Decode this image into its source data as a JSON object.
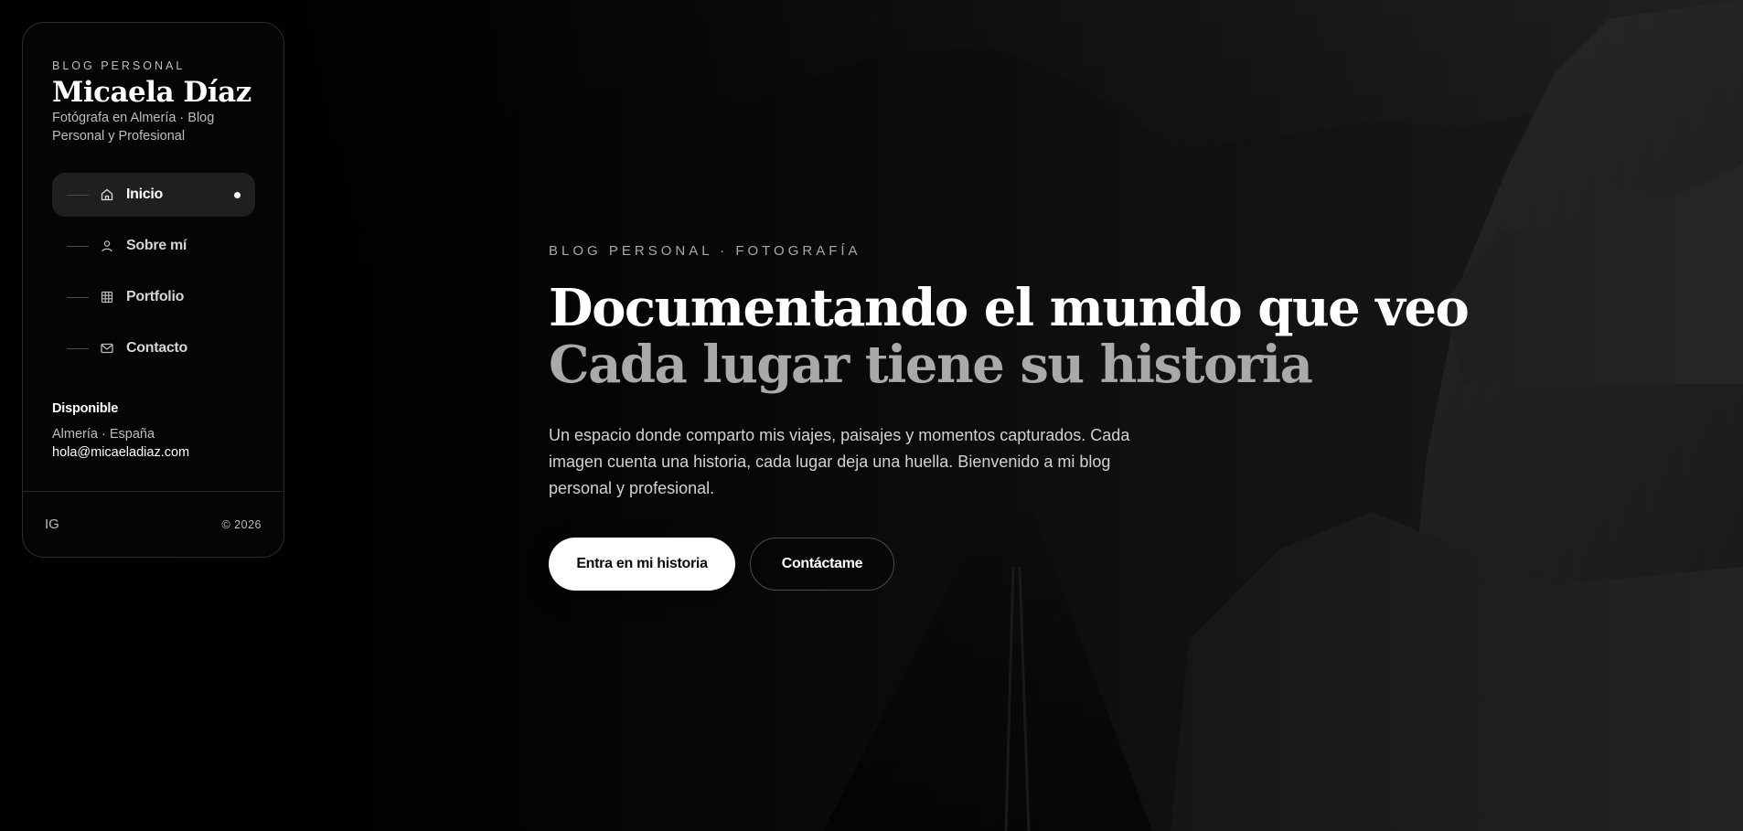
{
  "sidebar": {
    "eyebrow": "BLOG PERSONAL",
    "name": "Micaela Díaz",
    "subtitle": "Fotógrafa en Almería · Blog Personal y Profesional",
    "nav": [
      {
        "label": "Inicio",
        "icon": "home-icon",
        "active": true
      },
      {
        "label": "Sobre mí",
        "icon": "user-icon",
        "active": false
      },
      {
        "label": "Portfolio",
        "icon": "grid-icon",
        "active": false
      },
      {
        "label": "Contacto",
        "icon": "mail-icon",
        "active": false
      }
    ],
    "availability": {
      "title": "Disponible",
      "location": "Almería · España",
      "email": "hola@micaeladiaz.com"
    },
    "social": "IG",
    "copyright": "© 2026"
  },
  "hero": {
    "eyebrow": "BLOG PERSONAL · FOTOGRAFÍA",
    "title": "Documentando el mundo que veo",
    "subtitle": "Cada lugar tiene su historia",
    "description": "Un espacio donde comparto mis viajes, paisajes y momentos capturados. Cada imagen cuenta una historia, cada lugar deja una huella. Bienvenido a mi blog personal y profesional.",
    "primary_cta": "Entra en mi historia",
    "secondary_cta": "Contáctame"
  },
  "colors": {
    "background": "#000000",
    "panel": "#050505",
    "active_nav": "#1f1f1f",
    "muted_text": "#bdbdbd",
    "subtitle_gray": "#a9a9a9"
  }
}
